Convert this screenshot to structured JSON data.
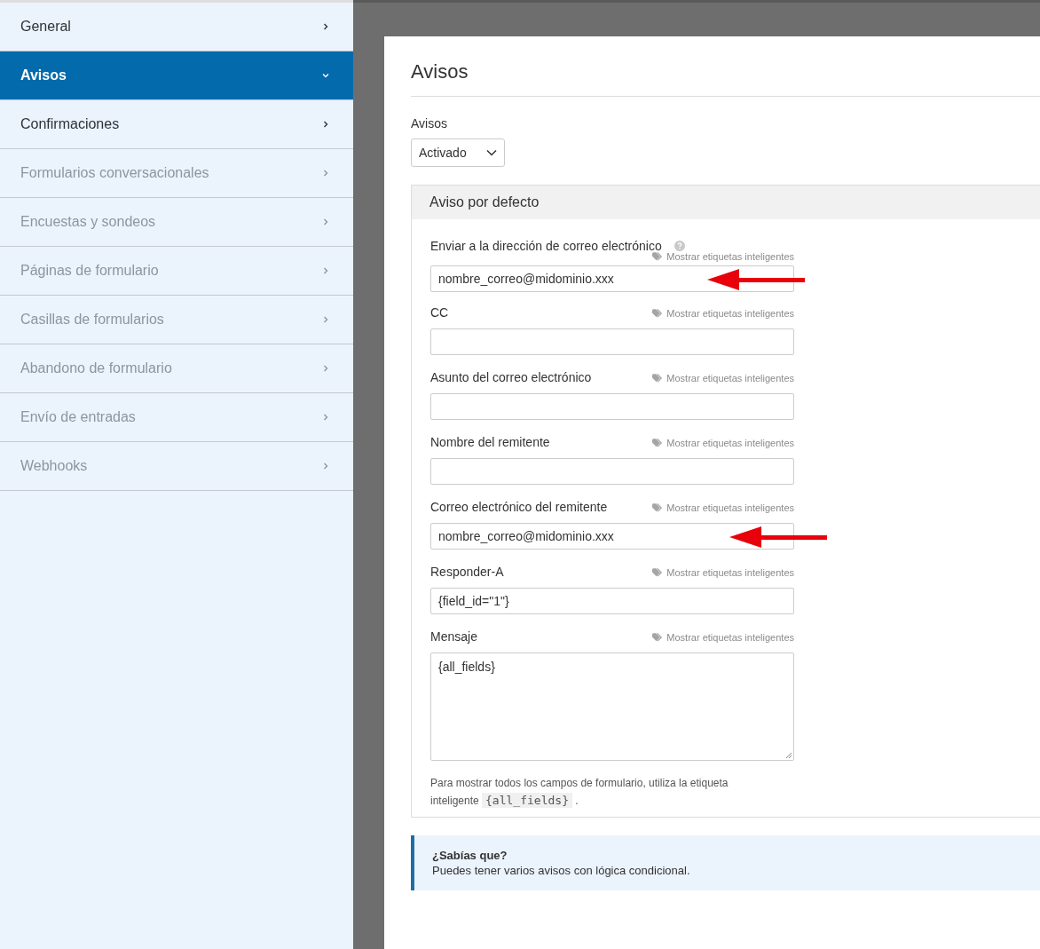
{
  "sidebar": {
    "items": [
      {
        "label": "General",
        "selected": false,
        "disabled": false
      },
      {
        "label": "Avisos",
        "selected": true,
        "disabled": false
      },
      {
        "label": "Confirmaciones",
        "selected": false,
        "disabled": false
      },
      {
        "label": "Formularios conversacionales",
        "selected": false,
        "disabled": true
      },
      {
        "label": "Encuestas y sondeos",
        "selected": false,
        "disabled": true
      },
      {
        "label": "Páginas de formulario",
        "selected": false,
        "disabled": true
      },
      {
        "label": "Casillas de formularios",
        "selected": false,
        "disabled": true
      },
      {
        "label": "Abandono de formulario",
        "selected": false,
        "disabled": true
      },
      {
        "label": "Envío de entradas",
        "selected": false,
        "disabled": true
      },
      {
        "label": "Webhooks",
        "selected": false,
        "disabled": true
      }
    ]
  },
  "panel": {
    "title": "Avisos",
    "toggle": {
      "label": "Avisos",
      "value": "Activado"
    },
    "section": {
      "title": "Aviso por defecto",
      "fields": [
        {
          "kind": "input",
          "label": "Enviar a la dirección de correo electrónico",
          "help": true,
          "smart_tags": "Mostrar etiquetas inteligentes",
          "value": "nombre_correo@midominio.xxx",
          "annotated": true
        },
        {
          "kind": "input",
          "label": "CC",
          "smart_tags": "Mostrar etiquetas inteligentes"
        },
        {
          "kind": "input",
          "label": "Asunto del correo electrónico",
          "smart_tags": "Mostrar etiquetas inteligentes"
        },
        {
          "kind": "input",
          "label": "Nombre del remitente",
          "smart_tags": "Mostrar etiquetas inteligentes"
        },
        {
          "kind": "input",
          "label": "Correo electrónico del remitente",
          "smart_tags": "Mostrar etiquetas inteligentes",
          "value": "nombre_correo@midominio.xxx",
          "annotated": true
        },
        {
          "kind": "input",
          "label": "Responder-A",
          "smart_tags": "Mostrar etiquetas inteligentes",
          "value": "{field_id=\"1\"}"
        },
        {
          "kind": "textarea",
          "label": "Mensaje",
          "smart_tags": "Mostrar etiquetas inteligentes",
          "value": "{all_fields}"
        }
      ],
      "note": {
        "before": "Para mostrar todos los campos de formulario, utiliza la etiqueta inteligente",
        "code": "{all_fields}",
        "after": "."
      }
    },
    "tip": {
      "title": "¿Sabías que?",
      "text": "Puedes tener varios avisos con lógica condicional."
    }
  }
}
